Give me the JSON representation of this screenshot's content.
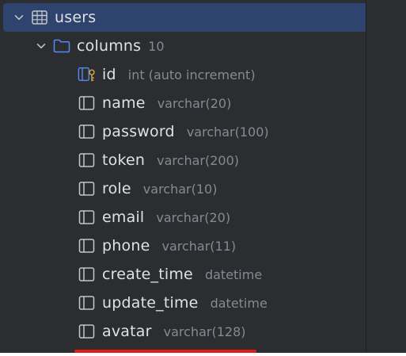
{
  "tree": {
    "table": {
      "name": "users"
    },
    "folder": {
      "name": "columns",
      "count": "10"
    },
    "columns": [
      {
        "name": "id",
        "type": "int (auto increment)",
        "icon": "primary-key-column-icon"
      },
      {
        "name": "name",
        "type": "varchar(20)",
        "icon": "column-icon"
      },
      {
        "name": "password",
        "type": "varchar(100)",
        "icon": "column-icon"
      },
      {
        "name": "token",
        "type": "varchar(200)",
        "icon": "column-icon"
      },
      {
        "name": "role",
        "type": "varchar(10)",
        "icon": "column-icon"
      },
      {
        "name": "email",
        "type": "varchar(20)",
        "icon": "column-icon"
      },
      {
        "name": "phone",
        "type": "varchar(11)",
        "icon": "column-icon"
      },
      {
        "name": "create_time",
        "type": "datetime",
        "icon": "column-icon"
      },
      {
        "name": "update_time",
        "type": "datetime",
        "icon": "column-icon"
      },
      {
        "name": "avatar",
        "type": "varchar(128)",
        "icon": "column-icon"
      }
    ]
  },
  "colors": {
    "background": "#2b2d30",
    "selection": "#2e436e",
    "text": "#dfe1e5",
    "muted": "#868a91",
    "folder_icon": "#548af7",
    "key_icon": "#d9a343",
    "annotation_underline": "#e21b1b"
  }
}
